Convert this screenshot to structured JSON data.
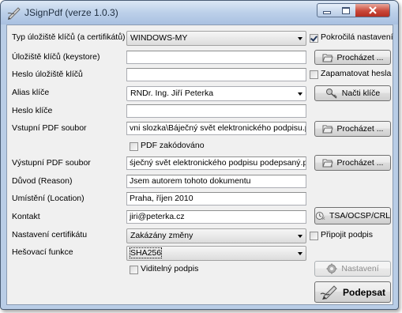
{
  "window": {
    "title": "JSignPdf (verze 1.0.3)"
  },
  "labels": {
    "keystore_type": "Typ úložiště klíčů (a certifikátů)",
    "keystore": "Úložiště klíčů (keystore)",
    "keystore_password": "Heslo úložiště klíčů",
    "key_alias": "Alias klíče",
    "key_password": "Heslo klíče",
    "input_pdf": "Vstupní PDF soubor",
    "output_pdf": "Výstupní PDF soubor",
    "reason": "Důvod (Reason)",
    "location": "Umístění (Location)",
    "contact": "Kontakt",
    "cert_settings": "Nastavení certifikátu",
    "hash": "Hešovací funkce"
  },
  "values": {
    "keystore_type": "WINDOWS-MY",
    "keystore": "",
    "keystore_password": "",
    "key_alias": "RNDr. Ing. Jiří Peterka",
    "key_password": "",
    "input_pdf": "vni slozka\\Báječný svět elektronického podpisu.pdf",
    "output_pdf": "śječný svět elektronického podpisu podepsaný.pdf",
    "reason": "Jsem autorem tohoto dokumentu",
    "location": "Praha, říjen 2010",
    "contact": "jiri@peterka.cz",
    "cert_settings": "Zakázány změny",
    "hash": "SHA256"
  },
  "checkboxes": {
    "advanced": {
      "label": "Pokročilá nastavení",
      "checked": true
    },
    "remember_password": {
      "label": "Zapamatovat hesla",
      "checked": false
    },
    "pdf_encrypted": {
      "label": "PDF zakódováno",
      "checked": false
    },
    "append_signature": {
      "label": "Připojit podpis",
      "checked": false
    },
    "visible_signature": {
      "label": "Viditelný podpis",
      "checked": false
    }
  },
  "buttons": {
    "browse_keystore": "Procházet ...",
    "load_keys": "Načti klíče",
    "browse_input": "Procházet ...",
    "browse_output": "Procházet ...",
    "tsa": "TSA/OCSP/CRL",
    "settings": "Nastavení",
    "sign": "Podepsat"
  },
  "icons": [
    "folder-icon",
    "keys-icon",
    "tsa-certificate-icon",
    "gear-icon",
    "pen-signature-icon"
  ]
}
